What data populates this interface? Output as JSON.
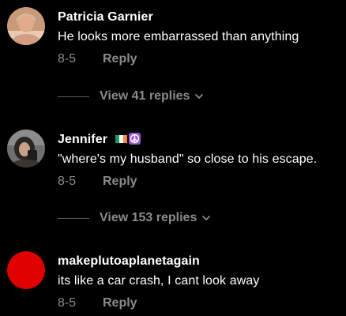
{
  "comments": [
    {
      "username": "Patricia Garnier",
      "text": "He looks more embarrassed than anything",
      "date": "8-5",
      "reply_label": "Reply",
      "view_replies": "View 41 replies",
      "avatar_icon": "user-photo-avatar"
    },
    {
      "username": "Jennifer",
      "badges": [
        "irish-flag-emoji",
        "peace-symbol-emoji"
      ],
      "text": "\"where's my husband\" so close to his escape.",
      "date": "8-5",
      "reply_label": "Reply",
      "view_replies": "View 153 replies",
      "avatar_icon": "user-photo-avatar"
    },
    {
      "username": "makeplutoaplanetagain",
      "text": "its like a car crash, I cant look away",
      "date": "8-5",
      "reply_label": "Reply",
      "avatar_icon": "red-circle-avatar",
      "avatar_color": "#e00000"
    }
  ],
  "colors": {
    "background": "#000000",
    "primary_text": "#ffffff",
    "secondary_text": "#8a8a8a",
    "divider": "#5a5a5a"
  }
}
